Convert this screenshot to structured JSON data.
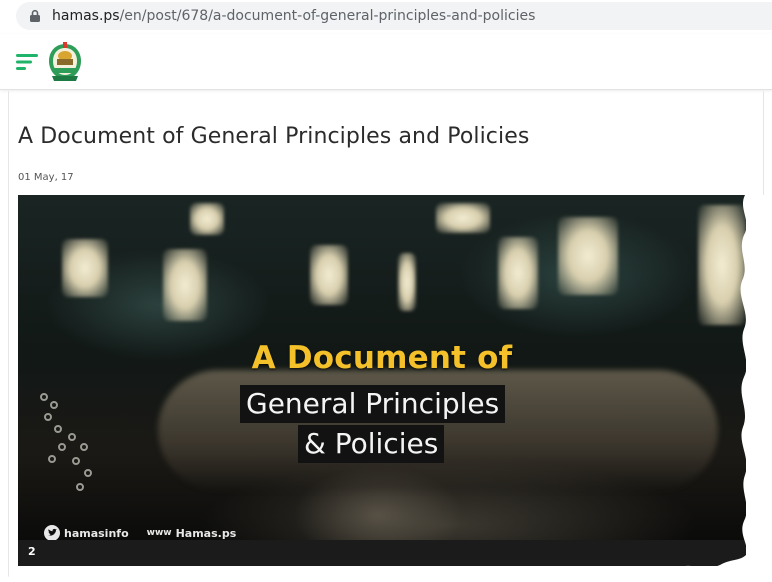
{
  "browser": {
    "url_host": "hamas.ps",
    "url_path": "/en/post/678/a-document-of-general-principles-and-policies",
    "icons": {
      "lock": "lock-icon"
    }
  },
  "header": {
    "menu_icon": "hamburger-menu-icon",
    "logo_icon": "hamas-emblem-logo",
    "accent_color": "#1fb46a"
  },
  "post": {
    "title": "A Document of General Principles and Policies",
    "date": "01 May, 17"
  },
  "video": {
    "overlay_line1": "A Document of",
    "overlay_line2": "General Principles",
    "overlay_line3": "& Policies",
    "social_twitter": "hamasinfo",
    "social_web": "Hamas.ps",
    "player_time": "2",
    "colors": {
      "title_yellow": "#f5c12a",
      "caption_bg": "#121212"
    }
  }
}
